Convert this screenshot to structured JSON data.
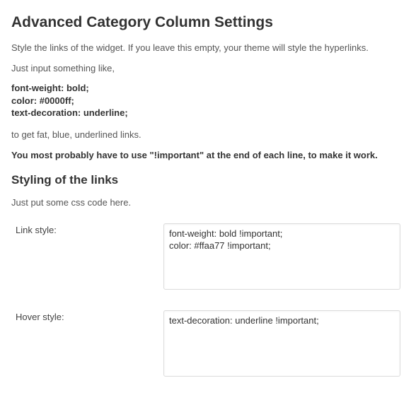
{
  "heading": "Advanced Category Column Settings",
  "intro": "Style the links of the widget. If you leave this empty, your theme will style the hyperlinks.",
  "prompt": "Just input something like,",
  "example_line1": "font-weight: bold;",
  "example_line2": "color: #0000ff;",
  "example_line3": "text-decoration: underline;",
  "result": "to get fat, blue, underlined links.",
  "note": "You most probably have to use \"!important\" at the end of each line, to make it work.",
  "section": {
    "title": "Styling of the links",
    "desc": "Just put some css code here."
  },
  "fields": {
    "link_style": {
      "label": "Link style:",
      "value": "font-weight: bold !important;\ncolor: #ffaa77 !important;"
    },
    "hover_style": {
      "label": "Hover style:",
      "value": "text-decoration: underline !important;"
    }
  }
}
